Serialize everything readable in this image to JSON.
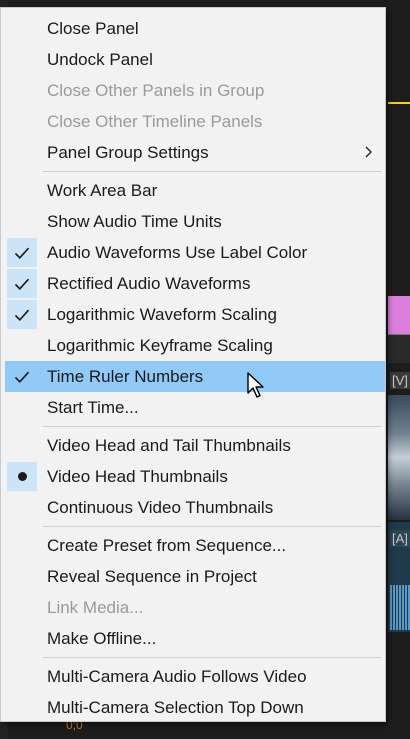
{
  "background": {
    "video_track_label": "[V]",
    "audio_track_label": "[A]",
    "bottom_value": "0;0"
  },
  "menu": {
    "groups": [
      [
        {
          "label": "Close Panel",
          "state": "none",
          "disabled": false
        },
        {
          "label": "Undock Panel",
          "state": "none",
          "disabled": false
        },
        {
          "label": "Close Other Panels in Group",
          "state": "none",
          "disabled": true
        },
        {
          "label": "Close Other Timeline Panels",
          "state": "none",
          "disabled": true
        },
        {
          "label": "Panel Group Settings",
          "state": "none",
          "disabled": false,
          "submenu": true
        }
      ],
      [
        {
          "label": "Work Area Bar",
          "state": "none",
          "disabled": false
        },
        {
          "label": "Show Audio Time Units",
          "state": "none",
          "disabled": false
        },
        {
          "label": "Audio Waveforms Use Label Color",
          "state": "checked",
          "disabled": false
        },
        {
          "label": "Rectified Audio Waveforms",
          "state": "checked",
          "disabled": false
        },
        {
          "label": "Logarithmic Waveform Scaling",
          "state": "checked",
          "disabled": false
        },
        {
          "label": "Logarithmic Keyframe Scaling",
          "state": "none",
          "disabled": false
        },
        {
          "label": "Time Ruler Numbers",
          "state": "checked",
          "disabled": false,
          "highlighted": true
        },
        {
          "label": "Start Time...",
          "state": "none",
          "disabled": false
        }
      ],
      [
        {
          "label": "Video Head and Tail Thumbnails",
          "state": "none",
          "disabled": false
        },
        {
          "label": "Video Head Thumbnails",
          "state": "radio",
          "disabled": false
        },
        {
          "label": "Continuous Video Thumbnails",
          "state": "none",
          "disabled": false
        }
      ],
      [
        {
          "label": "Create Preset from Sequence...",
          "state": "none",
          "disabled": false
        },
        {
          "label": "Reveal Sequence in Project",
          "state": "none",
          "disabled": false
        },
        {
          "label": "Link Media...",
          "state": "none",
          "disabled": true
        },
        {
          "label": "Make Offline...",
          "state": "none",
          "disabled": false
        }
      ],
      [
        {
          "label": "Multi-Camera Audio Follows Video",
          "state": "none",
          "disabled": false
        },
        {
          "label": "Multi-Camera Selection Top Down",
          "state": "none",
          "disabled": false
        }
      ]
    ]
  },
  "icons": {
    "check": "checkmark-icon",
    "radio": "radio-dot-icon",
    "submenu": "chevron-right-icon",
    "cursor": "mouse-pointer-icon"
  },
  "colors": {
    "menu_bg": "#f2f2f2",
    "highlight": "#91c9f7",
    "check_bg": "#cce4f7",
    "disabled_text": "#9a9a9a"
  }
}
